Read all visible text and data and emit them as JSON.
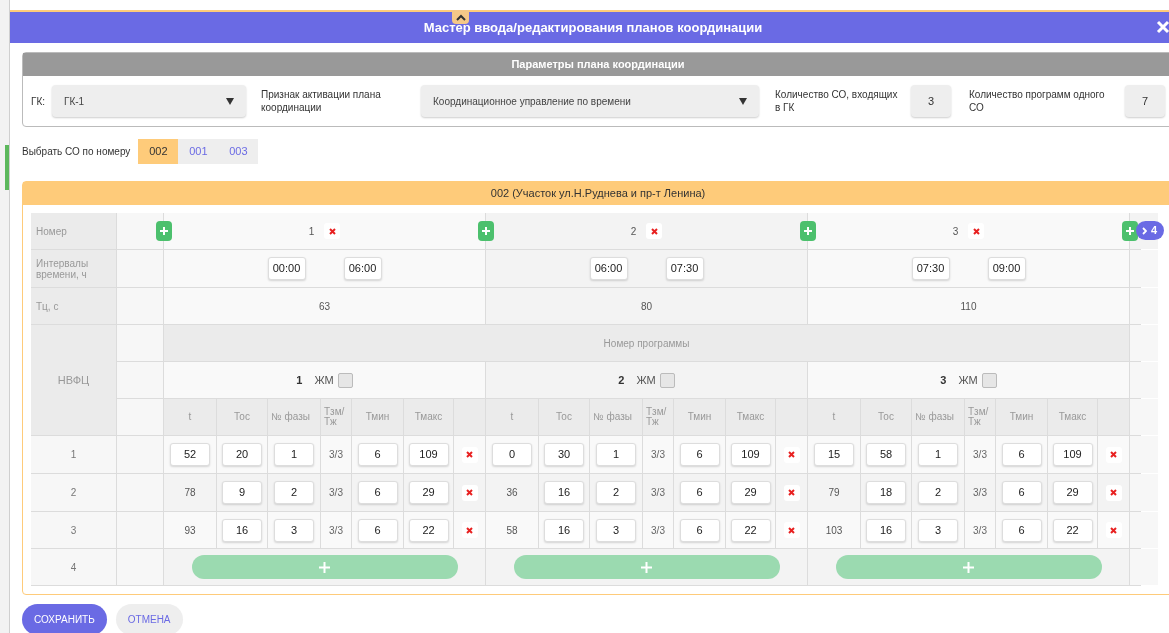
{
  "window": {
    "title": "Мастер ввода/редактирования планов координации"
  },
  "params": {
    "title": "Параметры плана координации",
    "gk_label": "ГК:",
    "gk_value": "ГК-1",
    "activation_label": "Признак активации плана координации",
    "activation_value": "Координационное управление по времени",
    "so_count_label": "Количество СО, входящих в ГК",
    "so_count_value": "3",
    "programs_label": "Количество программ одного СО",
    "programs_value": "7"
  },
  "so_selector": {
    "label": "Выбрать СО по номеру",
    "tabs": [
      {
        "label": "002",
        "selected": true
      },
      {
        "label": "001",
        "selected": false
      },
      {
        "label": "003",
        "selected": false
      }
    ]
  },
  "section": {
    "title": "002 (Участок ул.Н.Руднева и пр-т Ленина)",
    "row_labels": {
      "number": "Номер",
      "intervals": "Интервалы времени, ч",
      "cycle": "Тц, с",
      "nvfc": "НВФЦ"
    },
    "program_number_label": "Номер программы",
    "next_count": "4",
    "row_numbers": [
      "1",
      "2",
      "3",
      "4"
    ],
    "plans": [
      {
        "number": "1",
        "start": "00:00",
        "end": "06:00",
        "cycle": "63",
        "program": "1",
        "jm_label": "ЖМ",
        "jm_checked": false,
        "columns": [
          "t",
          "Тос",
          "№ фазы",
          "Тзм/ Тж",
          "Тмин",
          "Тмакс"
        ],
        "rows": [
          {
            "t": "52",
            "t_editable": true,
            "toc": "20",
            "phase": "1",
            "tzm": "3/3",
            "tmin": "6",
            "tmax": "109"
          },
          {
            "t": "78",
            "t_editable": false,
            "toc": "9",
            "phase": "2",
            "tzm": "3/3",
            "tmin": "6",
            "tmax": "29"
          },
          {
            "t": "93",
            "t_editable": false,
            "toc": "16",
            "phase": "3",
            "tzm": "3/3",
            "tmin": "6",
            "tmax": "22"
          }
        ]
      },
      {
        "number": "2",
        "start": "06:00",
        "end": "07:30",
        "cycle": "80",
        "program": "2",
        "jm_label": "ЖМ",
        "jm_checked": false,
        "columns": [
          "t",
          "Тос",
          "№ фазы",
          "Тзм/ Тж",
          "Тмин",
          "Тмакс"
        ],
        "rows": [
          {
            "t": "0",
            "t_editable": true,
            "toc": "30",
            "phase": "1",
            "tzm": "3/3",
            "tmin": "6",
            "tmax": "109"
          },
          {
            "t": "36",
            "t_editable": false,
            "toc": "16",
            "phase": "2",
            "tzm": "3/3",
            "tmin": "6",
            "tmax": "29"
          },
          {
            "t": "58",
            "t_editable": false,
            "toc": "16",
            "phase": "3",
            "tzm": "3/3",
            "tmin": "6",
            "tmax": "22"
          }
        ]
      },
      {
        "number": "3",
        "start": "07:30",
        "end": "09:00",
        "cycle": "110",
        "program": "3",
        "jm_label": "ЖМ",
        "jm_checked": false,
        "columns": [
          "t",
          "Тос",
          "№ фазы",
          "Тзм/ Тж",
          "Тмин",
          "Тмакс"
        ],
        "rows": [
          {
            "t": "15",
            "t_editable": true,
            "toc": "58",
            "phase": "1",
            "tzm": "3/3",
            "tmin": "6",
            "tmax": "109"
          },
          {
            "t": "79",
            "t_editable": false,
            "toc": "18",
            "phase": "2",
            "tzm": "3/3",
            "tmin": "6",
            "tmax": "29"
          },
          {
            "t": "103",
            "t_editable": false,
            "toc": "16",
            "phase": "3",
            "tzm": "3/3",
            "tmin": "6",
            "tmax": "22"
          }
        ]
      }
    ]
  },
  "buttons": {
    "save": "СОХРАНИТЬ",
    "cancel": "ОТМЕНА"
  }
}
